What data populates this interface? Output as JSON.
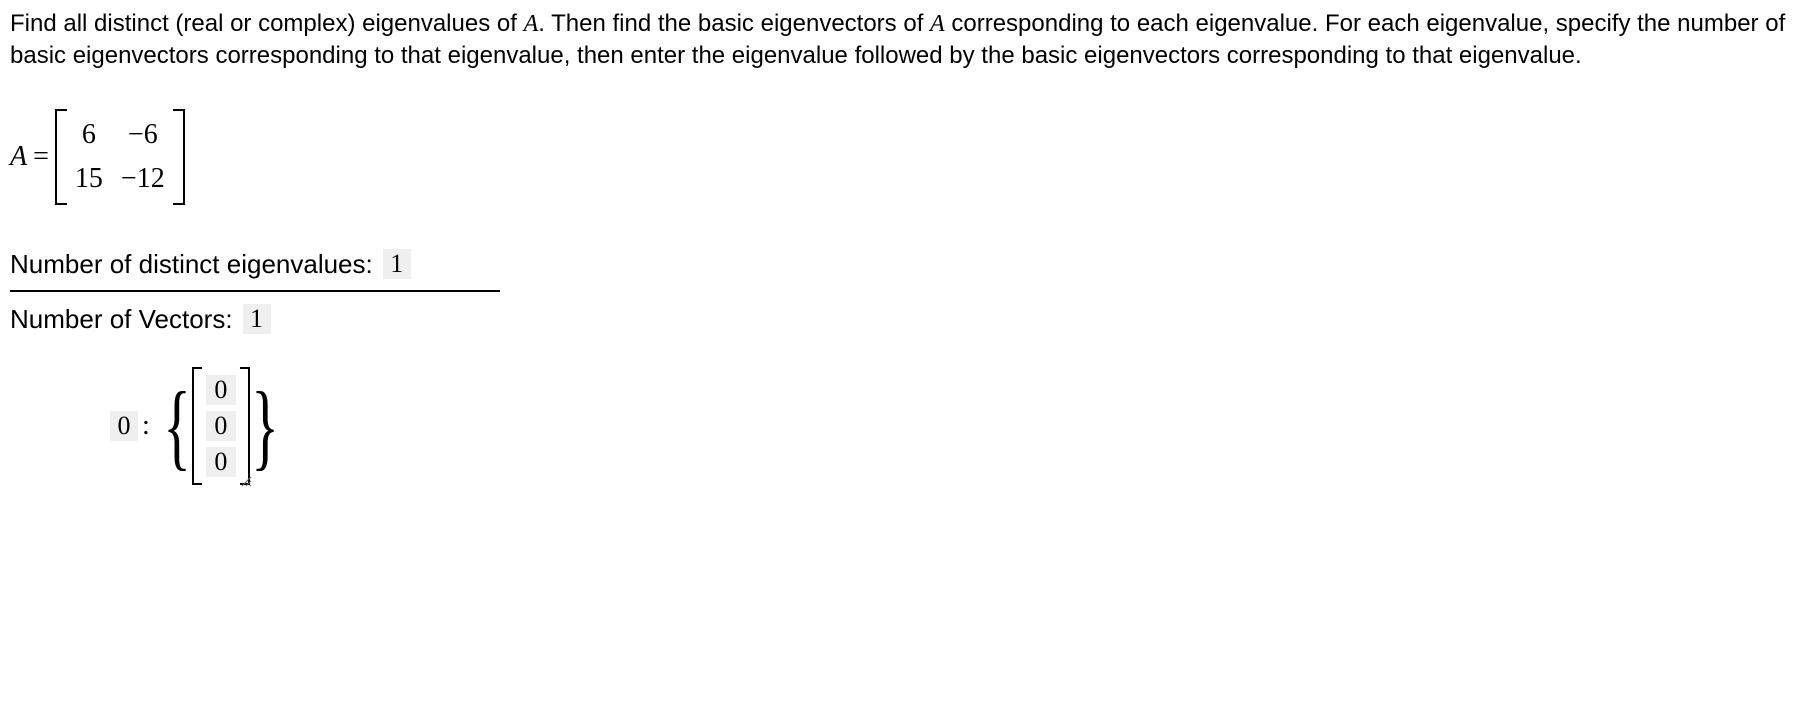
{
  "instructions": "Find all distinct (real or complex) eigenvalues of A. Then find the basic eigenvectors of A corresponding to each eigenvalue. For each eigenvalue, specify the number of basic eigenvectors corresponding to that eigenvalue, then enter the eigenvalue followed by the basic eigenvectors corresponding to that eigenvalue.",
  "matrix": {
    "name": "A",
    "equals": "=",
    "cells": {
      "r1c1": "6",
      "r1c2": "−6",
      "r2c1": "15",
      "r2c2": "−12"
    }
  },
  "labels": {
    "distinct_eigenvalues": "Number of distinct eigenvalues:",
    "num_vectors": "Number of Vectors:"
  },
  "inputs": {
    "distinct_eigenvalues": "1",
    "num_vectors": "1",
    "eigenvalue": "0",
    "colon": ":",
    "vector": {
      "v1": "0",
      "v2": "0",
      "v3": "0"
    }
  }
}
